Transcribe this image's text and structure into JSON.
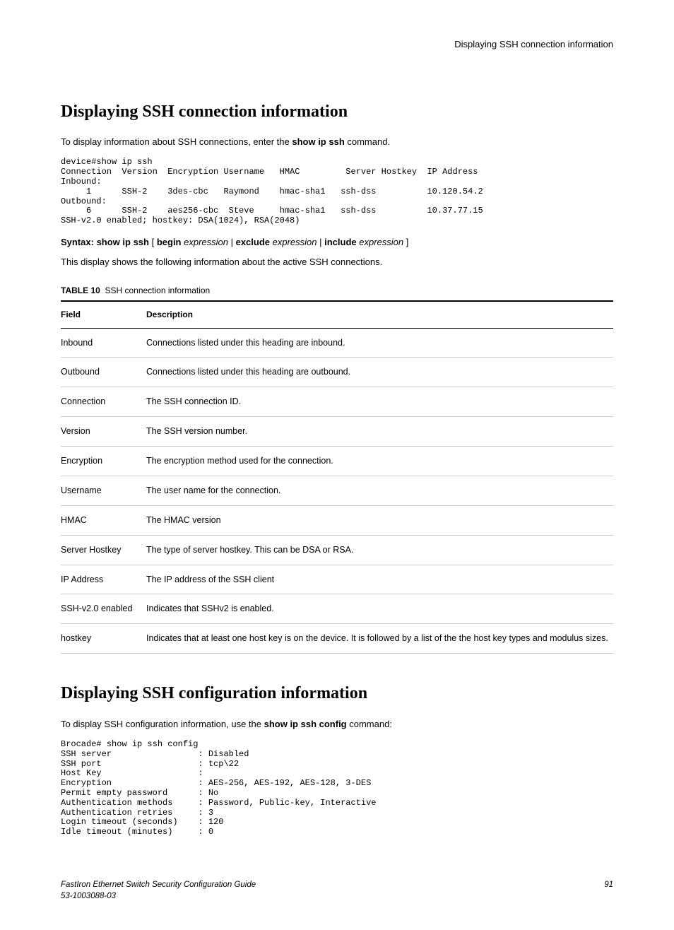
{
  "header": {
    "running_title": "Displaying SSH connection information"
  },
  "section1": {
    "heading": "Displaying SSH connection information",
    "intro_pre": "To display information about SSH connections, enter the ",
    "intro_cmd": "show ip ssh",
    "intro_post": " command.",
    "code": "device#show ip ssh\nConnection  Version  Encryption Username   HMAC         Server Hostkey  IP Address\nInbound:\n     1      SSH-2    3des-cbc   Raymond    hmac-sha1   ssh-dss          10.120.54.2\nOutbound:\n     6      SSH-2    aes256-cbc  Steve     hmac-sha1   ssh-dss          10.37.77.15\nSSH-v2.0 enabled; hostkey: DSA(1024), RSA(2048)",
    "syntax": {
      "label": "Syntax: show ip ssh",
      "lb": " [ ",
      "begin": "begin",
      "expr1": " expression",
      "sep1": " | ",
      "exclude": "exclude",
      "expr2": " expression",
      "sep2": " | ",
      "include": "include",
      "expr3": " expression",
      "rb": " ]"
    },
    "after_syntax": "This display shows the following information about the active SSH connections."
  },
  "table": {
    "caption_label": "TABLE 10",
    "caption_text": "SSH connection information",
    "head_field": "Field",
    "head_desc": "Description",
    "rows": [
      {
        "field": "Inbound",
        "desc": "Connections listed under this heading are inbound."
      },
      {
        "field": "Outbound",
        "desc": "Connections listed under this heading are outbound."
      },
      {
        "field": "Connection",
        "desc": "The SSH connection ID."
      },
      {
        "field": "Version",
        "desc": "The SSH version number."
      },
      {
        "field": "Encryption",
        "desc": "The encryption method used for the connection."
      },
      {
        "field": "Username",
        "desc": "The user name for the connection."
      },
      {
        "field": "HMAC",
        "desc": "The HMAC version"
      },
      {
        "field": "Server Hostkey",
        "desc": "The type of server hostkey. This can be DSA or RSA."
      },
      {
        "field": "IP Address",
        "desc": "The IP address of the SSH client"
      },
      {
        "field": "SSH-v2.0 enabled",
        "desc": "Indicates that SSHv2 is enabled."
      },
      {
        "field": "hostkey",
        "desc": "Indicates that at least one host key is on the device. It is followed by a list of the the host key types and modulus sizes."
      }
    ]
  },
  "section2": {
    "heading": "Displaying SSH configuration information",
    "intro_pre": "To display SSH configuration information, use the ",
    "intro_cmd": "show ip ssh config",
    "intro_post": " command:",
    "code": "Brocade# show ip ssh config\nSSH server                 : Disabled\nSSH port                   : tcp\\22\nHost Key                   :\nEncryption                 : AES-256, AES-192, AES-128, 3-DES\nPermit empty password      : No\nAuthentication methods     : Password, Public-key, Interactive\nAuthentication retries     : 3\nLogin timeout (seconds)    : 120\nIdle timeout (minutes)     : 0"
  },
  "footer": {
    "book": "FastIron Ethernet Switch Security Configuration Guide",
    "docnum": "53-1003088-03",
    "page": "91"
  }
}
